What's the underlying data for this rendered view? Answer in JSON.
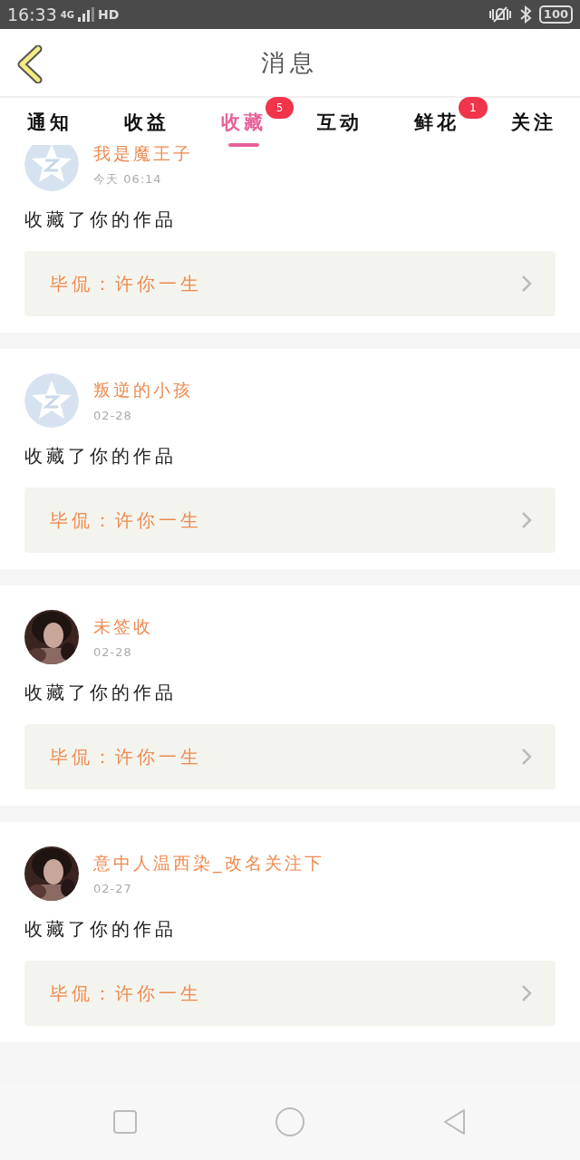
{
  "status_bar": {
    "time": "16:33",
    "network": "4G",
    "hd": "HD",
    "battery": "100"
  },
  "header": {
    "title": "消息"
  },
  "tabs": [
    {
      "label": "通知",
      "selected": false
    },
    {
      "label": "收益",
      "selected": false
    },
    {
      "label": "收藏",
      "selected": true,
      "badge": "5"
    },
    {
      "label": "互动",
      "selected": false
    },
    {
      "label": "鲜花",
      "selected": false,
      "badge": "1"
    },
    {
      "label": "关注",
      "selected": false
    }
  ],
  "messages": [
    {
      "avatar": {
        "kind": "default"
      },
      "name": "我是魔王子",
      "time": "今天 06:14",
      "text": "收藏了你的作品",
      "work": "毕侃：许你一生"
    },
    {
      "avatar": {
        "kind": "default"
      },
      "name": "叛逆的小孩",
      "time": "02-28",
      "text": "收藏了你的作品",
      "work": "毕侃：许你一生"
    },
    {
      "name": "未签收",
      "time": "02-28",
      "text": "收藏了你的作品",
      "work": "毕侃：许你一生"
    },
    {
      "name": "意中人温西染_改名关注下",
      "time": "02-27",
      "text": "收藏了你的作品",
      "work": "毕侃：许你一生"
    }
  ]
}
